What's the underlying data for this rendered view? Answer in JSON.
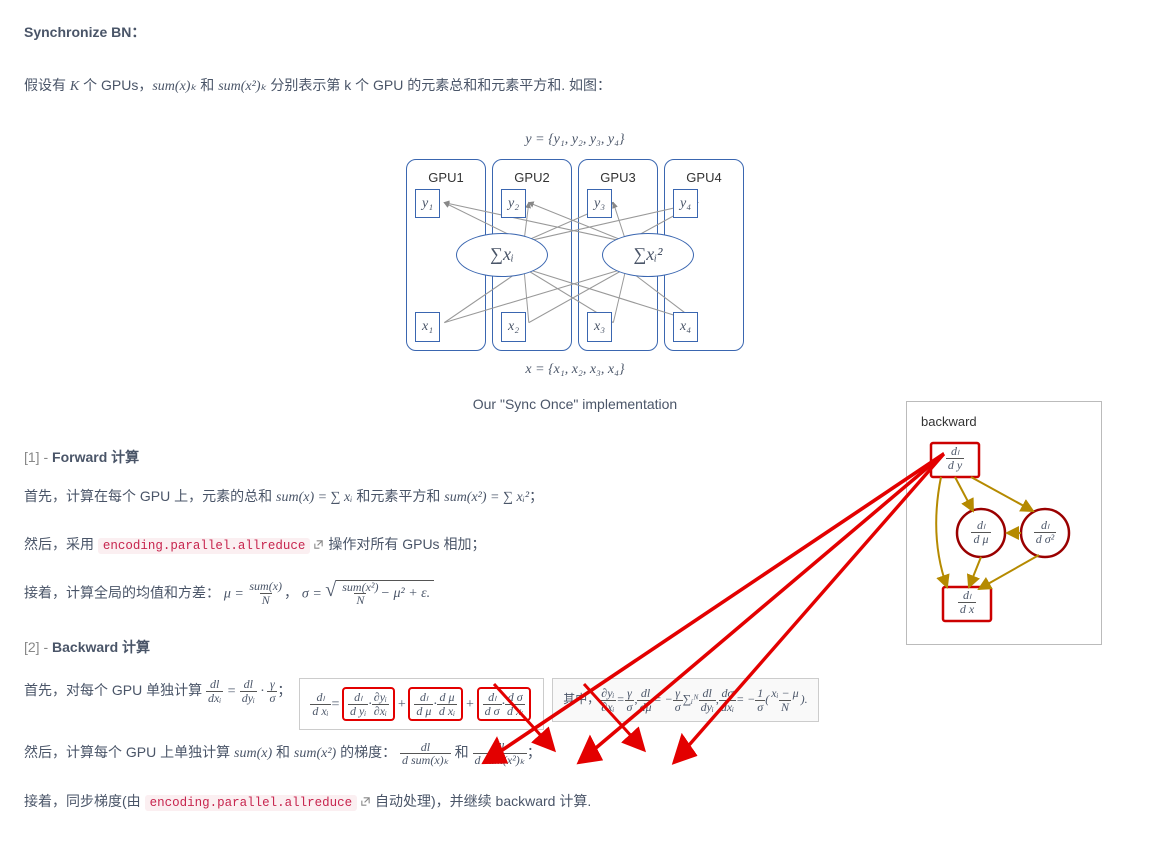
{
  "heading": "Synchronize BN：",
  "para1_pre": "假设有 ",
  "K": "K",
  "para1_mid1": " 个 GPUs，",
  "sumxk": "sum(x)ₖ",
  "para1_mid2": " 和 ",
  "sumx2k": "sum(x²)ₖ",
  "para1_post": " 分别表示第 k 个 GPU 的元素总和和元素平方和. 如图：",
  "diagram": {
    "y_set": "y = {y₁, y₂, y₃, y₄}",
    "gpus": [
      {
        "title": "GPU1",
        "y": "y₁",
        "x": "x₁"
      },
      {
        "title": "GPU2",
        "y": "y₂",
        "x": "x₂"
      },
      {
        "title": "GPU3",
        "y": "y₃",
        "x": "x₃"
      },
      {
        "title": "GPU4",
        "y": "y₄",
        "x": "x₄"
      }
    ],
    "ell1": "∑xᵢ",
    "ell2": "∑xᵢ²",
    "x_set": "x = {x₁, x₂, x₃, x₄}",
    "caption": "Our \"Sync Once\" implementation"
  },
  "sec1_label_num": "[1] - ",
  "sec1_label": "Forward 计算",
  "p_fwd1_a": "首先，计算在每个 GPU 上，元素的总和 ",
  "p_fwd1_eq1": "sum(x) = ∑ xᵢ",
  "p_fwd1_b": " 和元素平方和 ",
  "p_fwd1_eq2": "sum(x²) = ∑ xᵢ²",
  "p_fwd1_c": "；",
  "p_fwd2_a": "然后，采用 ",
  "code1": "encoding.parallel.allreduce",
  "p_fwd2_b": " 操作对所有 GPUs 相加；",
  "p_fwd3_a": "接着，计算全局的均值和方差：",
  "mu_lhs": "μ = ",
  "mu_num": "sum(x)",
  "mu_den": "N",
  "sep": "，",
  "sigma_lhs": "σ = ",
  "sigma_num": "sum(x²)",
  "sigma_den": "N",
  "sigma_tail": " − μ² + ε.",
  "sec2_label_num": "[2] - ",
  "sec2_label": "Backward 计算",
  "p_bwd1_a": "首先，对每个 GPU 单独计算 ",
  "dldxi_num": "dl",
  "dldxi_den": "dxᵢ",
  "eq": " = ",
  "dldyi_num": "dl",
  "dldyi_den": "dyᵢ",
  "dot": " · ",
  "gamma_num": "γ",
  "gamma_den": "σ",
  "semicolon": "；",
  "eqbox": {
    "lhs_num": "dₗ",
    "lhs_den": "d xᵢ",
    "eq1": " = ",
    "t1a_num": "dₗ",
    "t1a_den": "d yᵢ",
    "t1b_num": "∂yᵢ",
    "t1b_den": "∂xᵢ",
    "plus": " + ",
    "t2a_num": "dₗ",
    "t2a_den": "d μ",
    "t2b_num": "d μ",
    "t2b_den": "d xᵢ",
    "t3a_num": "dₗ",
    "t3a_den": "d σ",
    "t3b_num": "d σ",
    "t3b_den": "d xᵢ"
  },
  "eqbox2": {
    "pre": "其中，",
    "e1_num": "∂yᵢ",
    "e1_den": "∂xᵢ",
    "e1_eq": " = ",
    "e1r_num": "γ",
    "e1r_den": "σ",
    "c": ", ",
    "e2_num": "dl",
    "e2_den": "dμ",
    "e2_eq": " = −",
    "e2r_num": "γ",
    "e2r_den": "σ",
    "e2_sum": " ∑ᵢᴺ ",
    "e2s_num": "dl",
    "e2s_den": "dyᵢ",
    "e3_num": "dσ",
    "e3_den": "dxᵢ",
    "e3_eq": " = −",
    "e3r_num": "1",
    "e3r_den": "σ",
    "e3_par_open": " ( ",
    "e3p_num": "xᵢ − μ",
    "e3p_den": "N",
    "e3_par_close": " )."
  },
  "p_bwd2_a": "然后，计算每个 GPU 上单独计算 ",
  "sumx": "sum(x)",
  "and": " 和 ",
  "sumx2": "sum(x²)",
  "p_bwd2_b": " 的梯度：",
  "g1_num": "dl",
  "g1_den": "d sum(x)ₖ",
  "g2_num": "dl",
  "g2_den": "d sum(x²)ₖ",
  "p_bwd3_a": "接着，同步梯度(由 ",
  "code2": "encoding.parallel.allreduce",
  "p_bwd3_b": " 自动处理)，并继续 backward 计算.",
  "backward_title": "backward",
  "nodes": {
    "dy_num": "dₗ",
    "dy_den": "d y",
    "dmu_num": "dₗ",
    "dmu_den": "d μ",
    "ds2_num": "dₗ",
    "ds2_den": "d σ²",
    "dx_num": "dₗ",
    "dx_den": "d x"
  }
}
